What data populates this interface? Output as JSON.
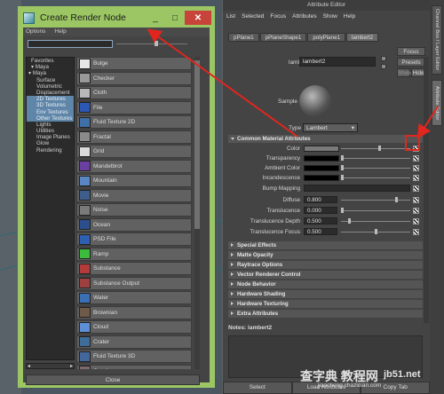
{
  "render_node": {
    "title": "Create Render Node",
    "minimize": "_",
    "maximize": "□",
    "close_glyph": "✕",
    "menu": [
      "Options",
      "Help"
    ],
    "tree": [
      {
        "label": "Favorites",
        "sel": false,
        "indent": 1
      },
      {
        "label": "▾ Maya",
        "sel": false,
        "indent": 1
      },
      {
        "label": "▾ Maya",
        "sel": false,
        "indent": 0
      },
      {
        "label": "Surface",
        "sel": false,
        "indent": 3
      },
      {
        "label": "Volumetric",
        "sel": false,
        "indent": 3
      },
      {
        "label": "Displacement",
        "sel": false,
        "indent": 3
      },
      {
        "label": "2D Textures",
        "sel": true,
        "indent": 3
      },
      {
        "label": "3D Textures",
        "sel": true,
        "indent": 3
      },
      {
        "label": "Env Textures",
        "sel": true,
        "indent": 3
      },
      {
        "label": "Other Textures",
        "sel": true,
        "indent": 3
      },
      {
        "label": "Lights",
        "sel": false,
        "indent": 3
      },
      {
        "label": "Utilities",
        "sel": false,
        "indent": 3
      },
      {
        "label": "Image Planes",
        "sel": false,
        "indent": 3
      },
      {
        "label": "Glow",
        "sel": false,
        "indent": 3
      },
      {
        "label": "Rendering",
        "sel": false,
        "indent": 3
      }
    ],
    "nodes": [
      {
        "label": "Bulge",
        "icon": "bulge-icon",
        "color": "#e6e6e6"
      },
      {
        "label": "Checker",
        "icon": "checker-icon",
        "color": "#9a9a9a"
      },
      {
        "label": "Cloth",
        "icon": "cloth-icon",
        "color": "#b8b8b8"
      },
      {
        "label": "File",
        "icon": "file-icon",
        "color": "#2c58b5"
      },
      {
        "label": "Fluid Texture 2D",
        "icon": "fluid-icon",
        "color": "#3f6fa6"
      },
      {
        "label": "Fractal",
        "icon": "fractal-icon",
        "color": "#8a8a8a"
      },
      {
        "label": "Grid",
        "icon": "grid-icon",
        "color": "#dcdcdc"
      },
      {
        "label": "Mandelbrot",
        "icon": "mandelbrot-icon",
        "color": "#6b3fa0"
      },
      {
        "label": "Mountain",
        "icon": "mountain-icon",
        "color": "#5a86c4"
      },
      {
        "label": "Movie",
        "icon": "movie-icon",
        "color": "#3f5d8a"
      },
      {
        "label": "Noise",
        "icon": "noise-icon",
        "color": "#7a7a7a"
      },
      {
        "label": "Ocean",
        "icon": "ocean-icon",
        "color": "#2a4f8c"
      },
      {
        "label": "PSD File",
        "icon": "psd-icon",
        "color": "#2e5fb2"
      },
      {
        "label": "Ramp",
        "icon": "ramp-icon",
        "color": "#3dbb3d"
      },
      {
        "label": "Substance",
        "icon": "substance-icon",
        "color": "#b33b3b"
      },
      {
        "label": "Substance Output",
        "icon": "substance-output-icon",
        "color": "#9e4040"
      },
      {
        "label": "Water",
        "icon": "water-icon",
        "color": "#3b6fb5"
      },
      {
        "label": "Brownian",
        "icon": "brownian-icon",
        "color": "#6e5a48"
      },
      {
        "label": "Cloud",
        "icon": "cloud-icon",
        "color": "#5e8fd6"
      },
      {
        "label": "Crater",
        "icon": "crater-icon",
        "color": "#3f6d9a"
      },
      {
        "label": "Fluid Texture 3D",
        "icon": "fluid3d-icon",
        "color": "#43679b"
      },
      {
        "label": "Granite",
        "icon": "granite-icon",
        "color": "#7b6a6a"
      }
    ],
    "close_label": "Close"
  },
  "attribute_editor": {
    "title": "Attribute Editor",
    "menu": [
      "List",
      "Selected",
      "Focus",
      "Attributes",
      "Show",
      "Help"
    ],
    "tabs": [
      "pPlane1",
      "pPlaneShape1",
      "polyPlane1",
      "lambert2"
    ],
    "node_type_label": "lambert:",
    "node_name": "lambert2",
    "focus": "Focus",
    "presets": "Presets",
    "show": "Show",
    "hide": "Hide",
    "sample_label": "Sample",
    "type_label": "Type",
    "type_value": "Lambert",
    "section_common": "Common Material Attributes",
    "attrs": [
      {
        "label": "Color",
        "kind": "swatch",
        "color": "#7a7a7a",
        "thumb": 0.55
      },
      {
        "label": "Transparency",
        "kind": "swatch",
        "color": "#000000",
        "thumb": 0.0
      },
      {
        "label": "Ambient Color",
        "kind": "swatch",
        "color": "#000000",
        "thumb": 0.0
      },
      {
        "label": "Incandescence",
        "kind": "swatch",
        "color": "#000000",
        "thumb": 0.0
      },
      {
        "label": "Bump Mapping",
        "kind": "bump"
      },
      {
        "label": "Diffuse",
        "kind": "num",
        "value": "0.800",
        "thumb": 0.8
      },
      {
        "label": "Translucence",
        "kind": "num",
        "value": "0.000",
        "thumb": 0.0
      },
      {
        "label": "Translucence Depth",
        "kind": "num",
        "value": "0.500",
        "thumb": 0.1
      },
      {
        "label": "Translucence Focus",
        "kind": "num",
        "value": "0.500",
        "thumb": 0.5
      }
    ],
    "sections": [
      "Special Effects",
      "Matte Opacity",
      "Raytrace Options",
      "Vector Renderer Control",
      "Node Behavior",
      "Hardware Shading",
      "Hardware Texturing",
      "Extra Attributes"
    ],
    "notes": "Notes:  lambert2",
    "bottom": [
      "Select",
      "Load Attributes",
      "Copy Tab"
    ]
  },
  "side_tabs": [
    "Channel Box / Layer Editor",
    "Attribute Editor"
  ],
  "watermark": {
    "line1": "查字典 教程网",
    "line2": "jb51.net",
    "line3": "jiaocheng.chazidian.com"
  }
}
